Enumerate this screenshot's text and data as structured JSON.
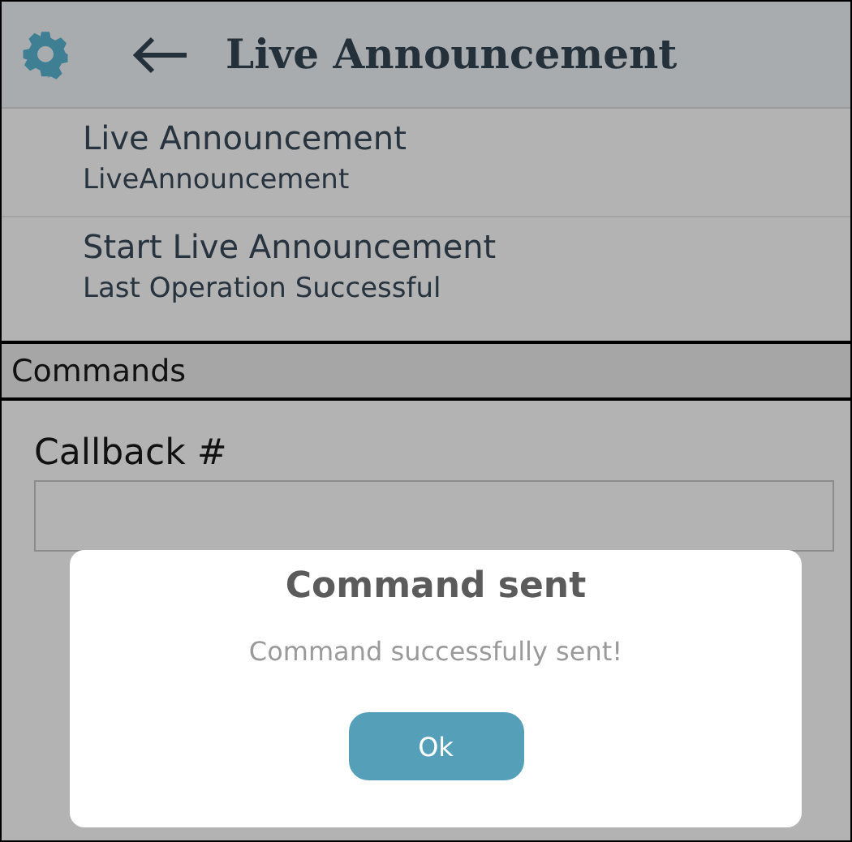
{
  "header": {
    "title": "Live Announcement"
  },
  "items": [
    {
      "title": "Live Announcement",
      "subtitle": "LiveAnnouncement"
    },
    {
      "title": "Start Live Announcement",
      "subtitle": "Last Operation Successful"
    }
  ],
  "section": {
    "title": "Commands"
  },
  "callback": {
    "label": "Callback #"
  },
  "dialog": {
    "title": "Command sent",
    "message": "Command successfully sent!",
    "button": "Ok"
  }
}
